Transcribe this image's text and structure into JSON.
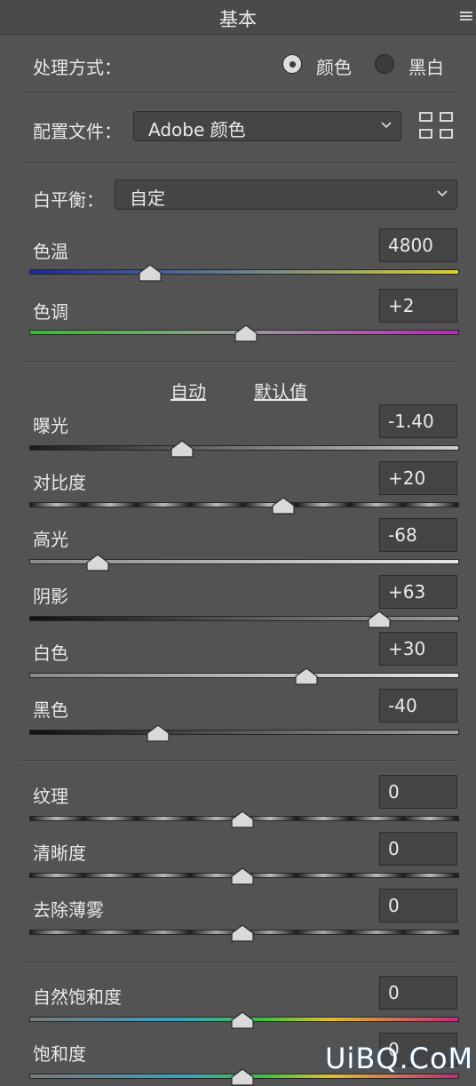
{
  "header": {
    "title": "基本",
    "menu_icon": "hamburger-menu-icon"
  },
  "treatment": {
    "label": "处理方式：",
    "options": [
      "颜色",
      "黑白"
    ],
    "selected": "颜色"
  },
  "profile": {
    "label": "配置文件：",
    "value": "Adobe 颜色",
    "browse_icon": "grid-icon"
  },
  "white_balance": {
    "label": "白平衡：",
    "value": "自定"
  },
  "actions": {
    "auto": "自动",
    "default": "默认值"
  },
  "sliders": [
    {
      "id": "temp",
      "label": "色温",
      "value": "4800",
      "position": 0.28,
      "track": "temp"
    },
    {
      "id": "tint",
      "label": "色调",
      "value": "+2",
      "position": 0.505,
      "track": "tint"
    },
    {
      "id": "exposure",
      "label": "曝光",
      "value": "-1.40",
      "position": 0.355,
      "track": "gray"
    },
    {
      "id": "contrast",
      "label": "对比度",
      "value": "+20",
      "position": 0.59,
      "track": "contrast"
    },
    {
      "id": "highlights",
      "label": "高光",
      "value": "-68",
      "position": 0.16,
      "track": "light"
    },
    {
      "id": "shadows",
      "label": "阴影",
      "value": "+63",
      "position": 0.815,
      "track": "dark"
    },
    {
      "id": "whites",
      "label": "白色",
      "value": "+30",
      "position": 0.645,
      "track": "light"
    },
    {
      "id": "blacks",
      "label": "黑色",
      "value": "-40",
      "position": 0.3,
      "track": "dark"
    },
    {
      "id": "texture",
      "label": "纹理",
      "value": "0",
      "position": 0.495,
      "track": "contrast"
    },
    {
      "id": "clarity",
      "label": "清晰度",
      "value": "0",
      "position": 0.495,
      "track": "contrast"
    },
    {
      "id": "dehaze",
      "label": "去除薄雾",
      "value": "0",
      "position": 0.495,
      "track": "dehaze"
    },
    {
      "id": "vibrance",
      "label": "自然饱和度",
      "value": "0",
      "position": 0.495,
      "track": "color"
    },
    {
      "id": "saturation",
      "label": "饱和度",
      "value": "0",
      "position": 0.495,
      "track": "color"
    }
  ],
  "watermark": "UiBQ.CoM",
  "colors": {
    "panel": "#535353",
    "header": "#4a4a4a",
    "field": "#444444",
    "thumb": "#d9d9d9"
  }
}
